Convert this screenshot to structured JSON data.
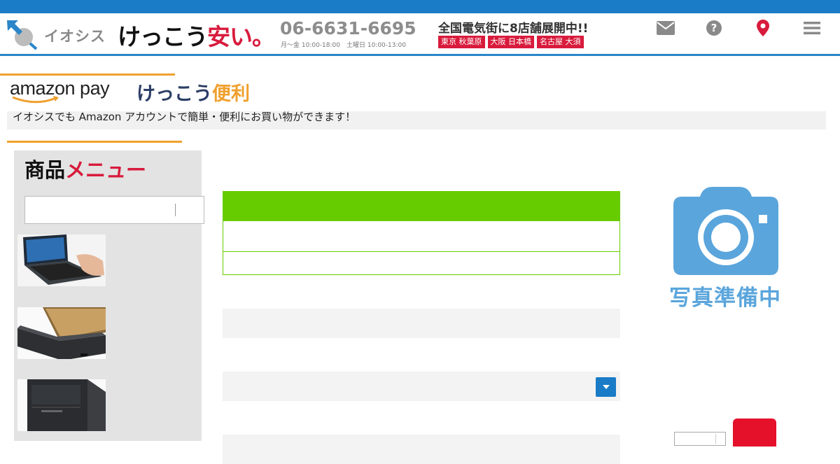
{
  "header": {
    "brand": "イオシス",
    "slogan_black": "けっこう",
    "slogan_red": "安い。",
    "phone": "06-6631-6695",
    "hours": "月〜金 10:00-18:00　土曜日 10:00-13:00",
    "stores_title": "全国電気街に8店舗展開中!!",
    "stores": [
      "東京 秋葉原",
      "大阪 日本橋",
      "名古屋 大須"
    ],
    "icons": [
      "mail-icon",
      "help-icon",
      "location-icon",
      "menu-icon"
    ],
    "colors": {
      "topbar": "#1a7bc7",
      "accent_red": "#d81b3c"
    }
  },
  "amazon": {
    "logo_text": "amazon pay",
    "tag_black": "けっこう",
    "tag_orange": "便利",
    "description": "イオシスでも Amazon アカウントで簡単・便利にお買い物ができます！",
    "colors": {
      "orange": "#f0a02e"
    }
  },
  "sidebar": {
    "title_black": "商品",
    "title_red": "メニュー",
    "search_value": "",
    "thumbnails": [
      "laptop-touch-thumbnail",
      "laptop-side-thumbnail",
      "desktop-tower-thumbnail"
    ]
  },
  "main": {
    "panel_color": "#66cc00",
    "select_button_icon": "caret-down-icon"
  },
  "photo": {
    "placeholder_text": "写真準備中",
    "icon": "camera-icon",
    "color": "#5aa5dc"
  },
  "cart": {
    "quantity_value": "",
    "button_color": "#e5102a"
  }
}
